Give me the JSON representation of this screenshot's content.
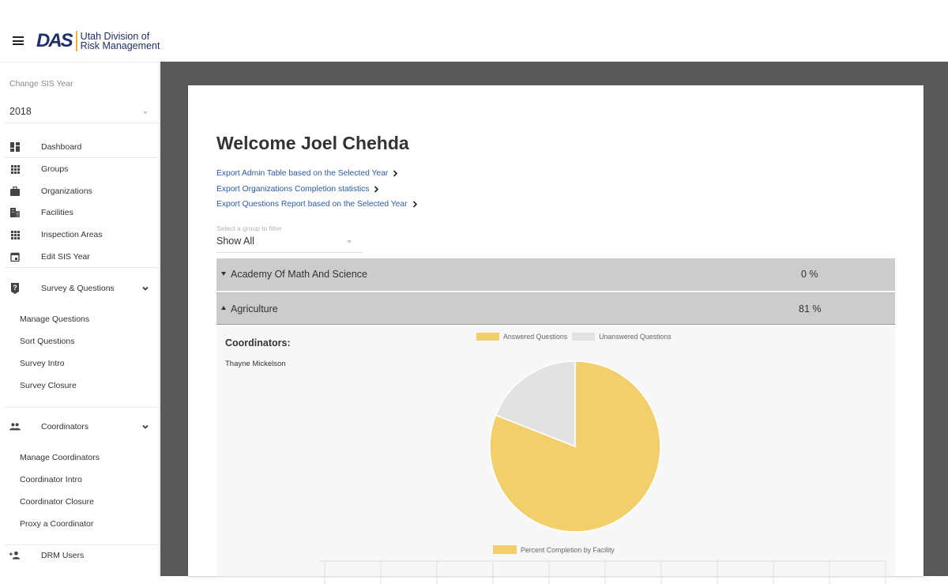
{
  "header": {
    "menu_icon": "hamburger-menu-icon",
    "logo_mark": "DAS",
    "logo_line1": "Utah Division of",
    "logo_line2": "Risk Management"
  },
  "sidebar": {
    "sis_year_label": "Change SIS Year",
    "sis_year_value": "2018",
    "items": [
      {
        "label": "Dashboard",
        "icon": "dashboard-icon"
      },
      {
        "label": "Groups",
        "icon": "grid-icon"
      },
      {
        "label": "Organizations",
        "icon": "briefcase-icon"
      },
      {
        "label": "Facilities",
        "icon": "building-icon"
      },
      {
        "label": "Inspection Areas",
        "icon": "grid-icon"
      },
      {
        "label": "Edit SIS Year",
        "icon": "calendar-icon"
      }
    ],
    "survey_section": {
      "label": "Survey & Questions",
      "icon": "question-icon",
      "sub_items": [
        "Manage Questions",
        "Sort Questions",
        "Survey Intro",
        "Survey Closure"
      ]
    },
    "coordinators_section": {
      "label": "Coordinators",
      "icon": "people-icon",
      "sub_items": [
        "Manage Coordinators",
        "Coordinator Intro",
        "Coordinator Closure",
        "Proxy a Coordinator"
      ]
    },
    "drm_users": {
      "label": "DRM Users",
      "icon": "add-person-icon"
    }
  },
  "main": {
    "welcome": "Welcome Joel Chehda",
    "export_links": [
      "Export Admin Table based on the Selected Year",
      "Export Organizations Completion statistics",
      "Export Questions Report based on the Selected Year"
    ],
    "filter_label": "Select a group to filter",
    "filter_value": "Show All",
    "groups": [
      {
        "name": "Academy Of Math And Science",
        "percent": "0 %",
        "expanded": false
      },
      {
        "name": "Agriculture",
        "percent": "81 %",
        "expanded": true
      }
    ],
    "coordinators_title": "Coordinators:",
    "coordinators": [
      "Thayne Mickelson"
    ]
  },
  "colors": {
    "answered": "#f3cf6b",
    "unanswered": "#e2e2e2",
    "link": "#2b5aa8",
    "group_row": "#cccccc",
    "main_bg": "#595959"
  },
  "chart_data": [
    {
      "type": "pie",
      "title": "",
      "legend": [
        "Answered Questions",
        "Unanswered Questions"
      ],
      "legend_position": "top",
      "categories": [
        "Answered Questions",
        "Unanswered Questions"
      ],
      "values": [
        81,
        19
      ]
    },
    {
      "type": "bar",
      "title": "",
      "legend": [
        "Percent Completion by Facility"
      ],
      "legend_position": "top",
      "series": [
        {
          "name": "Percent Completion by Facility",
          "values": []
        }
      ],
      "grid": true,
      "note": "chart truncated at bottom of screenshot; only gridlines visible"
    }
  ]
}
